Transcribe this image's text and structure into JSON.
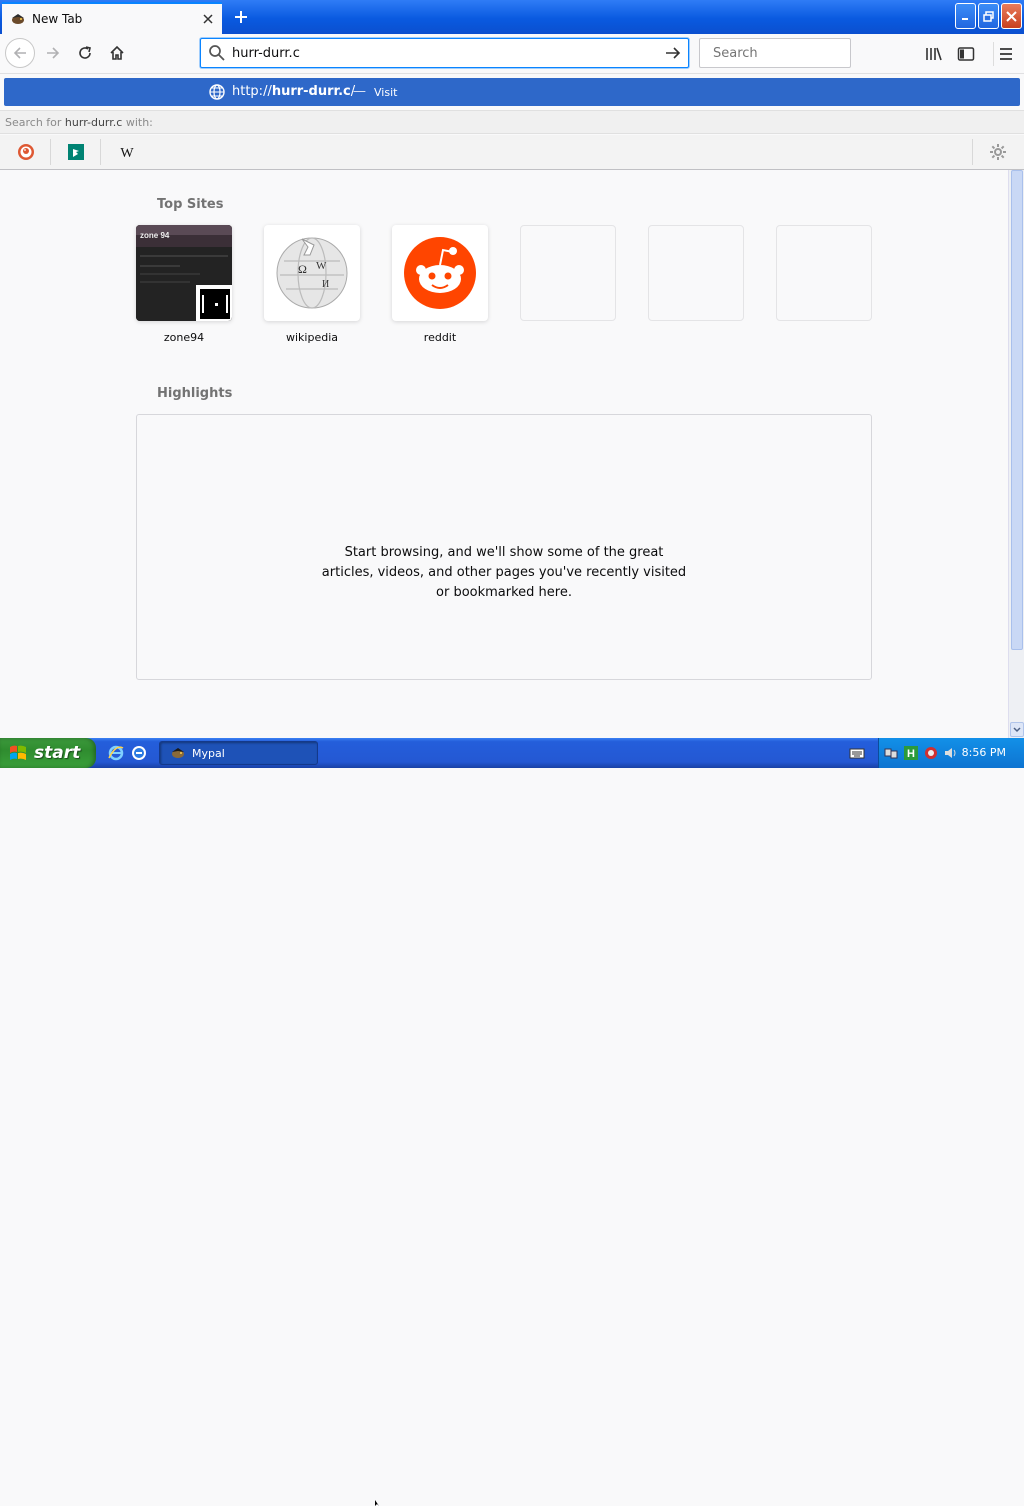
{
  "window": {
    "tab_title": "New Tab",
    "tab_favicon": "mypal-bird-icon"
  },
  "navbar": {
    "url_value": "hurr-durr.c",
    "search_placeholder": "Search"
  },
  "autocomplete": {
    "url_prefix": "http://",
    "url_bold": "hurr-durr.c",
    "url_suffix": "/",
    "separator": "—",
    "action": "Visit",
    "search_for_prefix": "Search for",
    "search_for_query": "hurr-durr.c",
    "search_for_suffix": "with:",
    "engines": [
      "duckduckgo-icon",
      "bing-icon",
      "wikipedia-icon"
    ]
  },
  "topsites": {
    "title": "Top Sites",
    "tiles": [
      {
        "label": "zone94"
      },
      {
        "label": "wikipedia"
      },
      {
        "label": "reddit"
      }
    ]
  },
  "highlights": {
    "title": "Highlights",
    "message": "Start browsing, and we'll show some of the great articles, videos, and other pages you've recently visited or bookmarked here."
  },
  "taskbar": {
    "start_label": "start",
    "task_label": "Mypal",
    "clock": "8:56 PM"
  },
  "colors": {
    "accent": "#0a84ff",
    "ac_selected": "#2e68c9",
    "reddit": "#ff4500",
    "taskbar": "#245edb"
  }
}
